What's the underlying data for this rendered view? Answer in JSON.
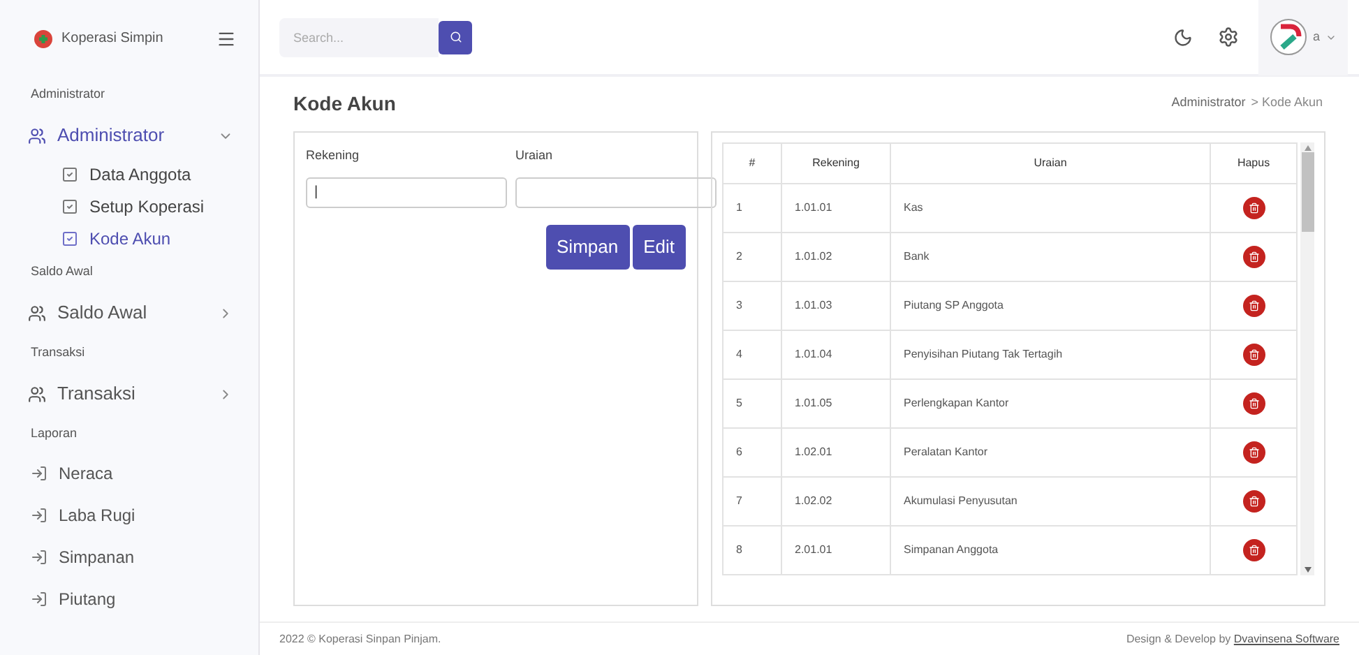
{
  "sidebar": {
    "brand": "Koperasi Simpin",
    "groups": [
      {
        "heading": "Administrator",
        "items": [
          {
            "kind": "menu",
            "label": "Administrator",
            "expanded": true,
            "children": [
              {
                "label": "Data Anggota",
                "selected": false
              },
              {
                "label": "Setup Koperasi",
                "selected": false
              },
              {
                "label": "Kode Akun",
                "selected": true
              }
            ]
          }
        ]
      },
      {
        "heading": "Saldo Awal",
        "items": [
          {
            "kind": "menu",
            "label": "Saldo Awal",
            "expanded": false
          }
        ]
      },
      {
        "heading": "Transaksi",
        "items": [
          {
            "kind": "menu",
            "label": "Transaksi",
            "expanded": false
          }
        ]
      },
      {
        "heading": "Laporan",
        "items": [
          {
            "kind": "link",
            "label": "Neraca"
          },
          {
            "kind": "link",
            "label": "Laba Rugi"
          },
          {
            "kind": "link",
            "label": "Simpanan"
          },
          {
            "kind": "link",
            "label": "Piutang"
          }
        ]
      }
    ]
  },
  "topbar": {
    "search": {
      "placeholder": "Search..."
    },
    "user": "a"
  },
  "page": {
    "title": "Kode Akun",
    "breadcrumb": [
      "Administrator",
      "> Kode Akun"
    ]
  },
  "form": {
    "fields": [
      {
        "label": "Rekening",
        "value": "|"
      },
      {
        "label": "Uraian"
      }
    ],
    "buttons": [
      "Simpan",
      "Edit"
    ]
  },
  "table": {
    "columns": [
      "#",
      "Rekening",
      "Uraian",
      "Hapus"
    ],
    "rows": [
      {
        "no": "1",
        "rekening": "1.01.01",
        "uraian": "Kas"
      },
      {
        "no": "2",
        "rekening": "1.01.02",
        "uraian": "Bank"
      },
      {
        "no": "3",
        "rekening": "1.01.03",
        "uraian": "Piutang SP Anggota"
      },
      {
        "no": "4",
        "rekening": "1.01.04",
        "uraian": "Penyisihan Piutang Tak Tertagih"
      },
      {
        "no": "5",
        "rekening": "1.01.05",
        "uraian": "Perlengkapan Kantor"
      },
      {
        "no": "6",
        "rekening": "1.02.01",
        "uraian": "Peralatan Kantor"
      },
      {
        "no": "7",
        "rekening": "1.02.02",
        "uraian": "Akumulasi Penyusutan"
      },
      {
        "no": "8",
        "rekening": "2.01.01",
        "uraian": "Simpanan Anggota"
      }
    ]
  },
  "footer": {
    "left": "2022 © Koperasi Sinpan Pinjam.",
    "right": "Design & Develop by",
    "link": "Dvavinsena Software"
  }
}
